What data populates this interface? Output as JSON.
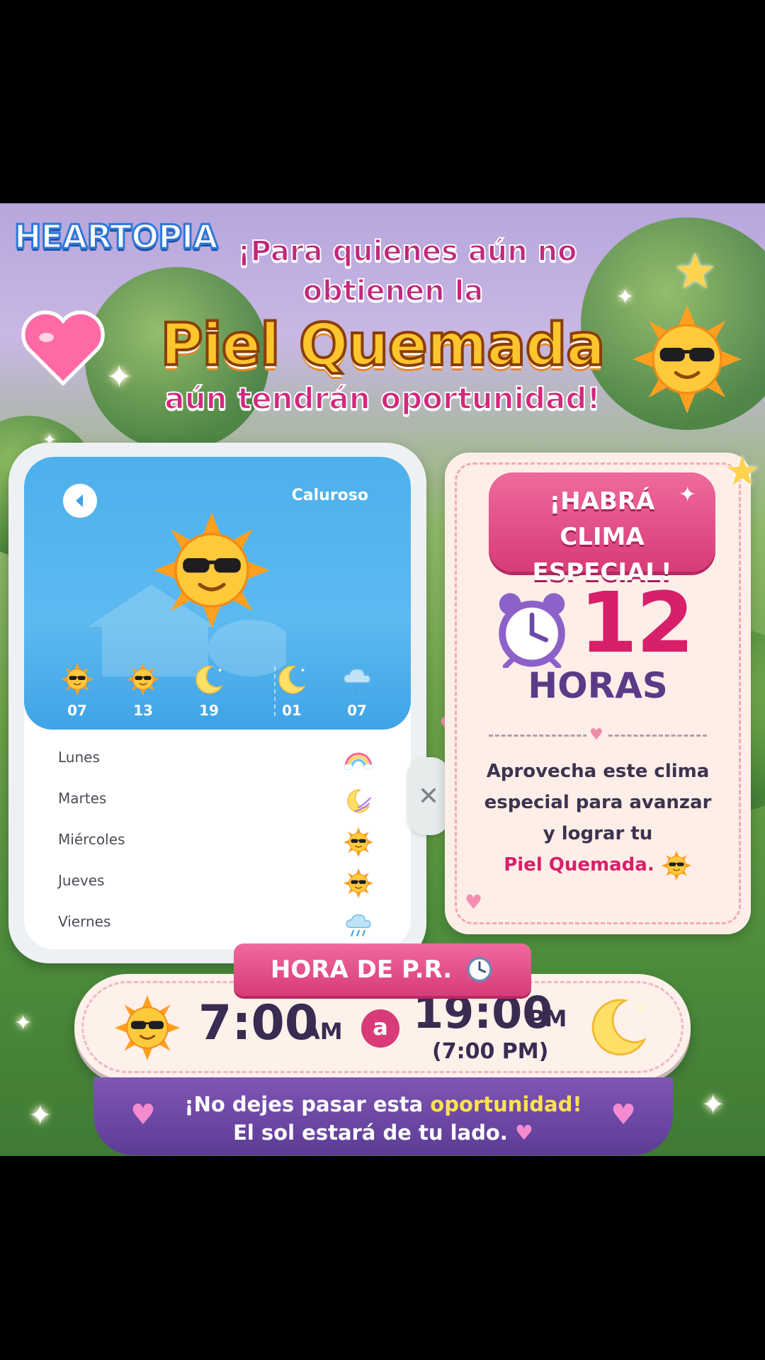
{
  "brand": {
    "logo": "HEARTOPIA"
  },
  "headline": {
    "line1": "¡Para quienes aún no",
    "line1b": "obtienen la",
    "line2": "Piel Quemada",
    "line3": "aún tendrán oportunidad!"
  },
  "forecast": {
    "current_label": "Caluroso",
    "hours": [
      {
        "time": "07",
        "icon": "sunglasses-sun-icon"
      },
      {
        "time": "13",
        "icon": "sunglasses-sun-icon"
      },
      {
        "time": "19",
        "icon": "crescent-moon-icon"
      },
      {
        "time": "01",
        "icon": "crescent-moon-icon"
      },
      {
        "time": "07",
        "icon": "rain-cloud-icon"
      }
    ],
    "days": [
      {
        "name": "Lunes",
        "icon": "rainbow-icon"
      },
      {
        "name": "Martes",
        "icon": "moon-wind-icon"
      },
      {
        "name": "Miércoles",
        "icon": "sunglasses-sun-icon"
      },
      {
        "name": "Jueves",
        "icon": "sunglasses-sun-icon"
      },
      {
        "name": "Viernes",
        "icon": "rain-cloud-icon"
      }
    ]
  },
  "info_card": {
    "banner_line1": "¡HABRÁ",
    "banner_line2": "CLIMA ESPECIAL!",
    "count": "12",
    "unit": "HORAS",
    "text1": "Aprovecha este clima",
    "text2": "especial para avanzar",
    "text3": "y lograr tu",
    "highlight": "Piel Quemada."
  },
  "schedule": {
    "tag": "HORA DE P.R.",
    "start_time": "7:00",
    "start_unit": "AM",
    "connector": "a",
    "end_time": "19:00",
    "end_unit": "PM",
    "end_alt": "(7:00 PM)"
  },
  "footer": {
    "line1_pre": "¡No dejes pasar esta",
    "line1_hl": "oportunidad!",
    "line2": "El sol estará de tu lado."
  },
  "colors": {
    "pink": "#d83b78",
    "purple": "#5c3c95",
    "sky": "#4db0ec",
    "sun": "#ffb22c"
  }
}
